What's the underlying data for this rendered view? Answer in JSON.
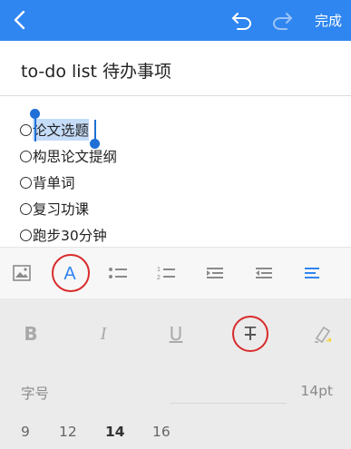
{
  "header": {
    "done_label": "完成",
    "bg_color": "#2f86f0",
    "back_icon": "chevron-left-icon",
    "undo_icon": "undo-icon",
    "redo_icon": "redo-icon"
  },
  "document": {
    "title": "to-do list 待办事项",
    "items": [
      {
        "label": "论文选题",
        "selected": true
      },
      {
        "label": "构思论文提纲",
        "selected": false
      },
      {
        "label": "背单词",
        "selected": false
      },
      {
        "label": "复习功课",
        "selected": false
      },
      {
        "label": "跑步30分钟",
        "selected": false
      }
    ]
  },
  "format_toolbar": {
    "items": [
      {
        "icon": "image-icon"
      },
      {
        "icon": "text-style-icon",
        "label": "A",
        "active": true
      },
      {
        "icon": "bullet-list-icon"
      },
      {
        "icon": "numbered-list-icon"
      },
      {
        "icon": "outdent-icon"
      },
      {
        "icon": "indent-icon"
      },
      {
        "icon": "align-icon"
      }
    ]
  },
  "style_bar": {
    "bold": "B",
    "italic": "I",
    "underline": "U",
    "strikethrough": "T",
    "highlight_icon": "highlighter-icon"
  },
  "font_size": {
    "label": "字号",
    "value": "14pt",
    "options": [
      "9",
      "12",
      "14",
      "16"
    ],
    "selected": "14"
  },
  "colors": {
    "accent": "#2f86f0",
    "annotation_red": "#d92b2b"
  }
}
